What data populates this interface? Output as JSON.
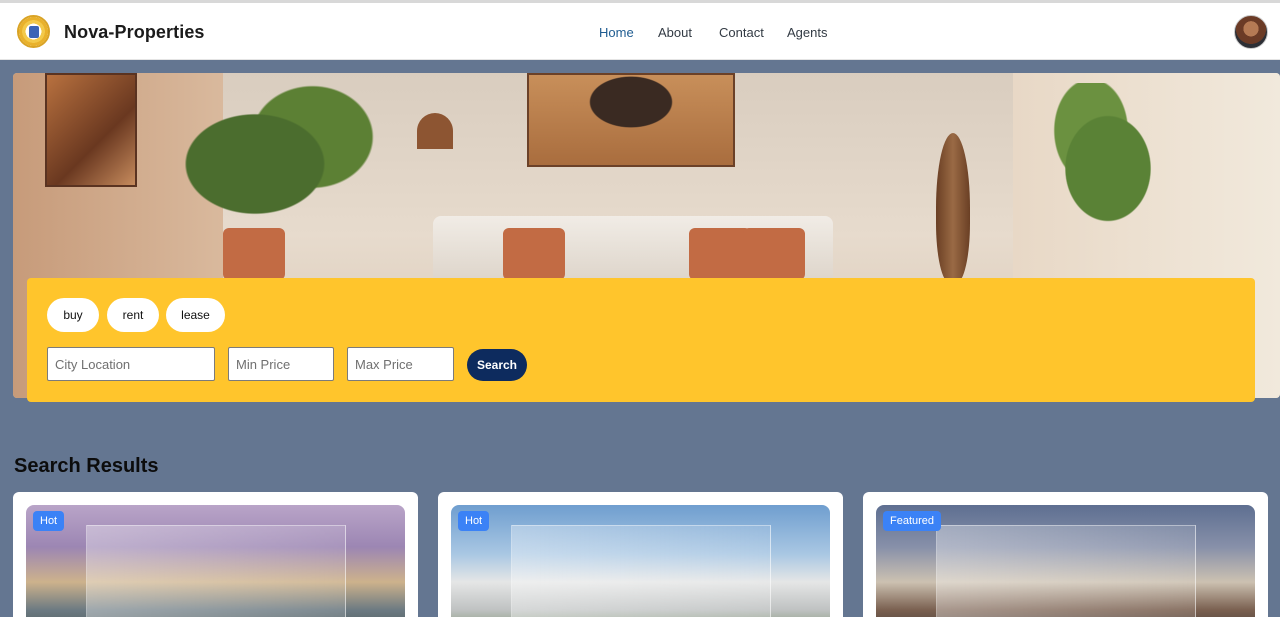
{
  "header": {
    "brand": "Nova-Properties",
    "nav": [
      {
        "label": "Home",
        "active": true
      },
      {
        "label": "About",
        "active": false
      },
      {
        "label": "Contact",
        "active": false
      },
      {
        "label": "Agents",
        "active": false
      }
    ]
  },
  "search": {
    "modes": [
      "buy",
      "rent",
      "lease"
    ],
    "city_placeholder": "City Location",
    "min_placeholder": "Min Price",
    "max_placeholder": "Max Price",
    "button_label": "Search"
  },
  "results": {
    "title": "Search Results",
    "cards": [
      {
        "badge": "Hot"
      },
      {
        "badge": "Hot"
      },
      {
        "badge": "Featured"
      }
    ]
  },
  "colors": {
    "accent_yellow": "#ffc52c",
    "navy": "#0d2b5e",
    "badge_blue": "#3b82f6",
    "page_bg": "#647691"
  }
}
